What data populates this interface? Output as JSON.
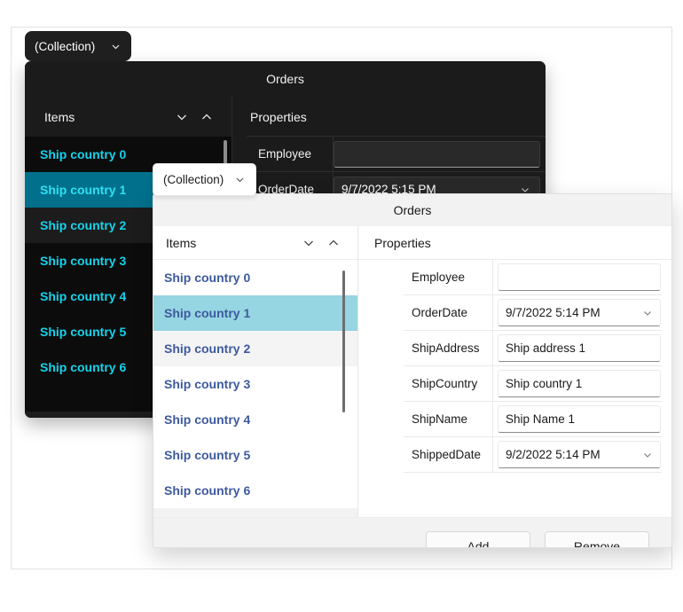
{
  "collection_pill_dark": {
    "label": "(Collection)",
    "icon": "chevron-down-icon"
  },
  "collection_pill_light": {
    "label": "(Collection)",
    "icon": "chevron-down-icon"
  },
  "dark_dialog": {
    "title": "Orders",
    "items_header": {
      "label": "Items",
      "move_down_icon": "chevron-down-icon",
      "move_up_icon": "chevron-up-icon"
    },
    "properties_header": "Properties",
    "items": [
      "Ship country 0",
      "Ship country 1",
      "Ship country 2",
      "Ship country 3",
      "Ship country 4",
      "Ship country 5",
      "Ship country 6"
    ],
    "selected_index": 1,
    "properties": [
      {
        "name": "Employee",
        "value": "",
        "type": "text"
      },
      {
        "name": "OrderDate",
        "value": "9/7/2022 5:15 PM",
        "type": "date"
      }
    ],
    "colors": {
      "background": "#101010",
      "titlebar": "#1b1b1b",
      "accent_text": "#13d3ec",
      "selection": "#01708c"
    }
  },
  "light_dialog": {
    "title": "Orders",
    "items_header": {
      "label": "Items",
      "move_down_icon": "chevron-down-icon",
      "move_up_icon": "chevron-up-icon"
    },
    "properties_header": "Properties",
    "items": [
      "Ship country 0",
      "Ship country 1",
      "Ship country 2",
      "Ship country 3",
      "Ship country 4",
      "Ship country 5",
      "Ship country 6"
    ],
    "selected_index": 1,
    "properties": [
      {
        "name": "Employee",
        "value": "",
        "type": "text"
      },
      {
        "name": "OrderDate",
        "value": "9/7/2022 5:14 PM",
        "type": "date"
      },
      {
        "name": "ShipAddress",
        "value": "Ship address 1",
        "type": "text"
      },
      {
        "name": "ShipCountry",
        "value": "Ship country 1",
        "type": "text"
      },
      {
        "name": "ShipName",
        "value": "Ship Name 1",
        "type": "text"
      },
      {
        "name": "ShippedDate",
        "value": "9/2/2022 5:14 PM",
        "type": "date"
      }
    ],
    "buttons": {
      "add": "Add",
      "remove": "Remove"
    },
    "colors": {
      "background": "#ffffff",
      "titlebar": "#f2f2f2",
      "item_text": "#3d5a9e",
      "selection": "#96d5e2"
    }
  }
}
